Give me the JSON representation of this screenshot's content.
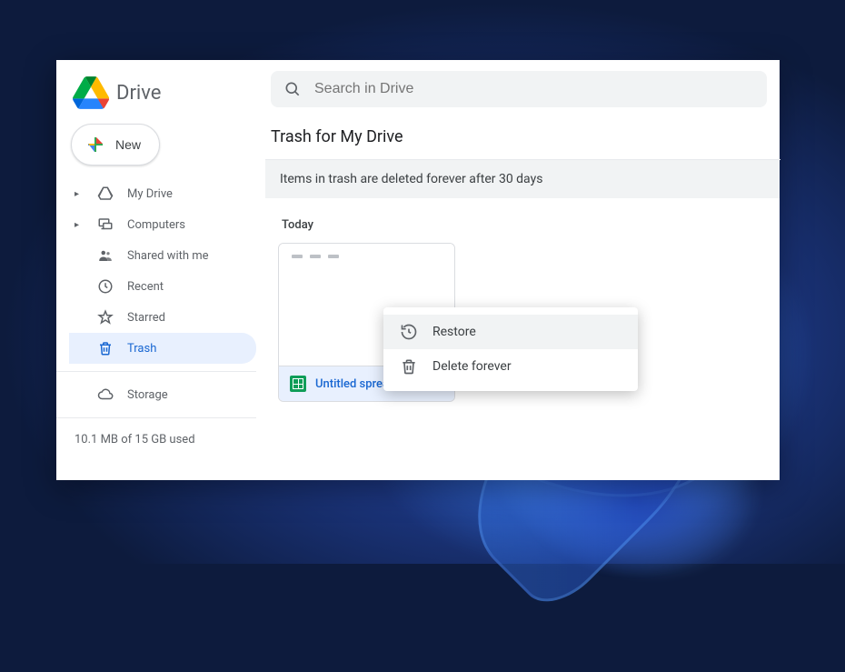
{
  "app": {
    "name": "Drive"
  },
  "sidebar": {
    "newButton": "New",
    "items": [
      {
        "label": "My Drive",
        "icon": "drive-icon",
        "expandable": true
      },
      {
        "label": "Computers",
        "icon": "computers-icon",
        "expandable": true
      },
      {
        "label": "Shared with me",
        "icon": "shared-icon",
        "expandable": false
      },
      {
        "label": "Recent",
        "icon": "clock-icon",
        "expandable": false
      },
      {
        "label": "Starred",
        "icon": "star-icon",
        "expandable": false
      },
      {
        "label": "Trash",
        "icon": "trash-icon",
        "expandable": false,
        "active": true
      }
    ],
    "storageItem": {
      "label": "Storage",
      "icon": "cloud-icon"
    },
    "storageText": "10.1 MB of 15 GB used"
  },
  "search": {
    "placeholder": "Search in Drive"
  },
  "main": {
    "title": "Trash for My Drive",
    "banner": "Items in trash are deleted forever after 30 days",
    "sectionLabel": "Today",
    "file": {
      "name": "Untitled spreadsheet",
      "type": "sheets"
    }
  },
  "contextMenu": {
    "items": [
      {
        "label": "Restore",
        "icon": "restore-icon"
      },
      {
        "label": "Delete forever",
        "icon": "trash-icon"
      }
    ]
  }
}
